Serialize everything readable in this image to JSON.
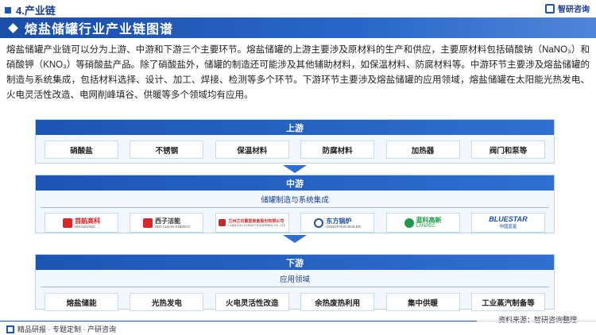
{
  "header": {
    "section": "4.产业链",
    "brand": "智研咨询",
    "title": "熔盐储罐行业产业链图谱"
  },
  "intro": {
    "p1": "熔盐储罐产业链可以分为上游、中游和下游三个主要环节。熔盐储罐的上游主要涉及原材料的生产和供应，主要原材料包括硝酸钠（NaNO₃）和硝酸钾（KNO₃）等硝酸盐产品。除了硝酸盐外，储罐的制造还可能涉及其他辅助材料，如保温材料、防腐材料等。中游环节主要涉及熔盐储罐的制造与系统集成，包括材料选择、设计、加工、焊接、检测等多个环节。下游环节主要涉及熔盐储罐的应用领域，熔盐储罐在太阳能光热发电、火电灵活性改造、电网削峰填谷、供暖等多个领域均有应用。"
  },
  "upstream": {
    "title": "上游",
    "items": [
      "硝酸盐",
      "不锈钢",
      "保温材料",
      "防腐材料",
      "加热器",
      "阀门和泵等"
    ]
  },
  "midstream": {
    "title": "中游",
    "subtitle": "储罐制造与系统集成",
    "companies": [
      {
        "name": "首航高科",
        "sub": "SHOUHANG",
        "color": "#d9262a"
      },
      {
        "name": "西子洁能",
        "sub": "XIZI CLEAN ENERGY",
        "color": "#d9262a"
      },
      {
        "name": "兰州兰石重型装备股份有限公司",
        "sub": "LANZHOU LS HEAVY EQUIPMENT CO., LTD",
        "color": "#c62828"
      },
      {
        "name": "东方锅炉",
        "sub": "DONGFANG BOILER",
        "color": "#1f4fa3"
      },
      {
        "name": "蓝科高新",
        "sub": "LANPEC",
        "color": "#1e9a49"
      },
      {
        "name": "BLUESTAR",
        "sub": "中国蓝星",
        "color": "#1f4fa3"
      }
    ]
  },
  "downstream": {
    "title": "下游",
    "subtitle": "应用领域",
    "items": [
      "熔盐储能",
      "光热发电",
      "火电灵活性改造",
      "余热废热利用",
      "集中供暖",
      "工业蒸汽制备等"
    ]
  },
  "footer": {
    "left": "精品研报 · 专题定制 · 产研咨询",
    "source": "资料来源：智研咨询整理"
  },
  "colors": {
    "primary": "#1a56b8",
    "panel_bg": "#f3f8fe",
    "panel_border": "#b8d2ef"
  }
}
